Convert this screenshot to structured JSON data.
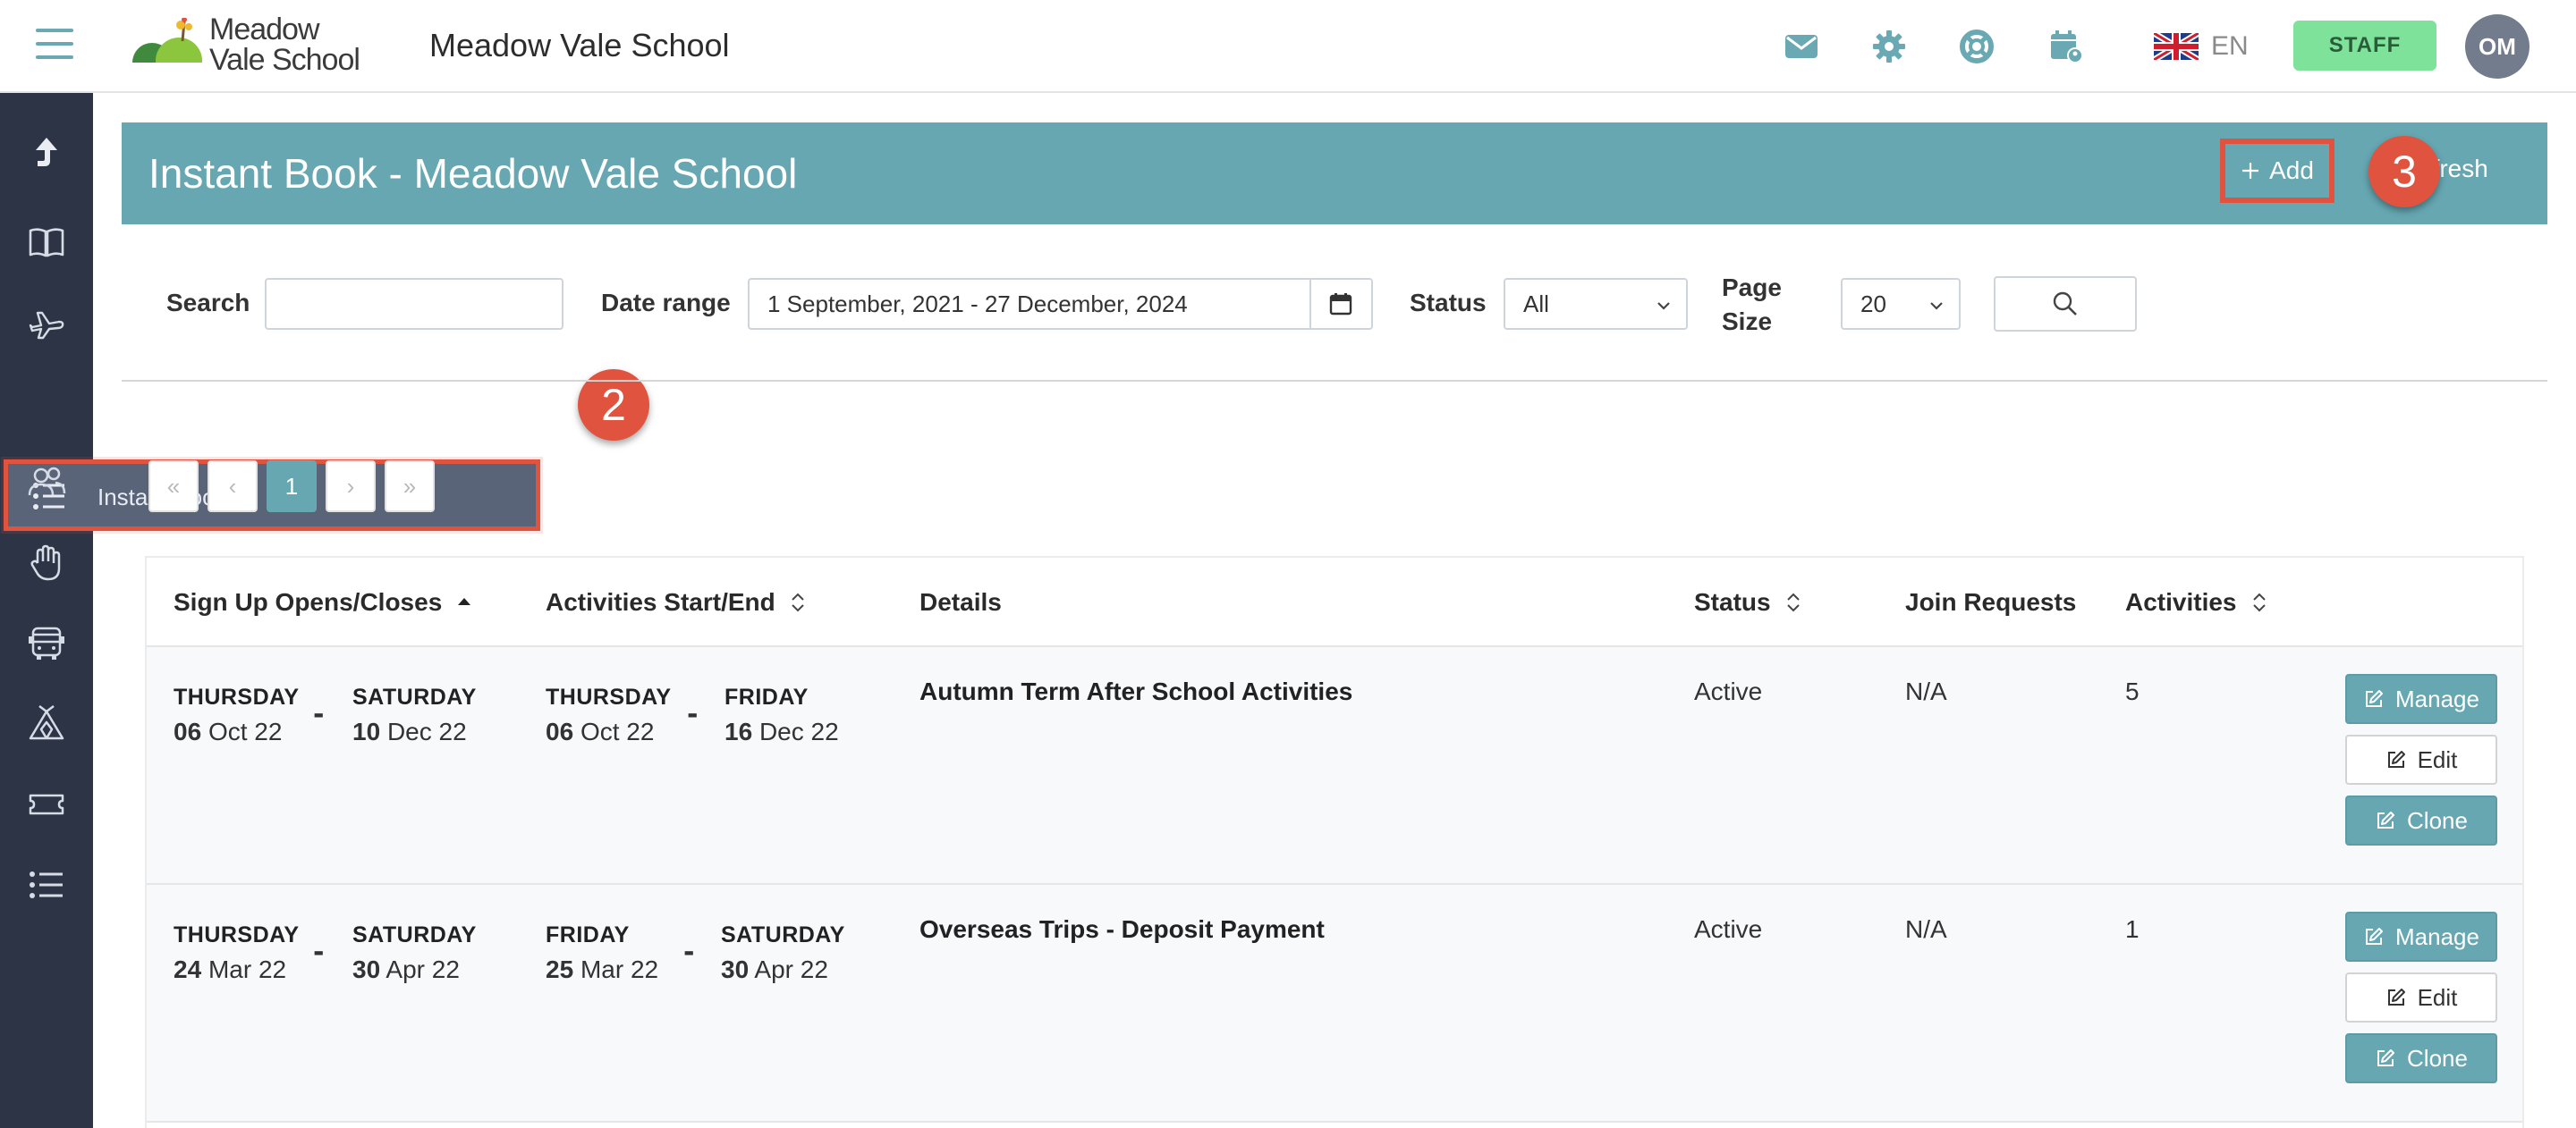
{
  "header": {
    "logo_line1": "Meadow",
    "logo_line2": "Vale School",
    "school_title": "Meadow Vale School",
    "icons": [
      "mail-icon",
      "gear-icon",
      "lifebuoy-icon",
      "calendar-user-icon"
    ],
    "language": "EN",
    "staff_label": "STAFF",
    "avatar_initials": "OM"
  },
  "sidebar": {
    "items": [
      "upload-arrow-icon",
      "book-icon",
      "plane-icon",
      "list-icon",
      "users-icon",
      "hand-icon",
      "bus-icon",
      "tent-icon",
      "ticket-icon",
      "list-icon"
    ],
    "active_label": "Instant Book"
  },
  "callouts": {
    "sidebar_step": "2",
    "add_step": "3"
  },
  "panel": {
    "title": "Instant Book - Meadow Vale School",
    "add_label": "Add",
    "refresh_label": "efresh"
  },
  "filters": {
    "search_label": "Search",
    "search_value": "",
    "date_range_label": "Date range",
    "date_range_value": "1 September, 2021 - 27 December, 2024",
    "status_label": "Status",
    "status_value": "All",
    "page_size_label_1": "Page",
    "page_size_label_2": "Size",
    "page_size_value": "20"
  },
  "pagination": {
    "first": "«",
    "prev": "‹",
    "current": "1",
    "next": "›",
    "last": "»"
  },
  "table": {
    "columns": {
      "signup": "Sign Up Opens/Closes",
      "activities_start": "Activities Start/End",
      "details": "Details",
      "status": "Status",
      "join": "Join Requests",
      "activities": "Activities"
    },
    "rows": [
      {
        "signup_open_day": "THURSDAY",
        "signup_open_num": "06",
        "signup_open_rest": "Oct 22",
        "signup_close_day": "SATURDAY",
        "signup_close_num": "10",
        "signup_close_rest": "Dec 22",
        "start_day": "THURSDAY",
        "start_num": "06",
        "start_rest": "Oct 22",
        "end_day": "FRIDAY",
        "end_num": "16",
        "end_rest": "Dec 22",
        "details": "Autumn Term After School Activities",
        "status": "Active",
        "join": "N/A",
        "activities": "5"
      },
      {
        "signup_open_day": "THURSDAY",
        "signup_open_num": "24",
        "signup_open_rest": "Mar 22",
        "signup_close_day": "SATURDAY",
        "signup_close_num": "30",
        "signup_close_rest": "Apr 22",
        "start_day": "FRIDAY",
        "start_num": "25",
        "start_rest": "Mar 22",
        "end_day": "SATURDAY",
        "end_num": "30",
        "end_rest": "Apr 22",
        "details": "Overseas Trips - Deposit Payment",
        "status": "Active",
        "join": "N/A",
        "activities": "1"
      }
    ],
    "actions": {
      "manage": "Manage",
      "edit": "Edit",
      "clone": "Clone"
    }
  },
  "colors": {
    "teal": "#66a7b2",
    "sidebar": "#2d3446",
    "highlight": "#e0533f",
    "staff": "#7ee29a"
  }
}
